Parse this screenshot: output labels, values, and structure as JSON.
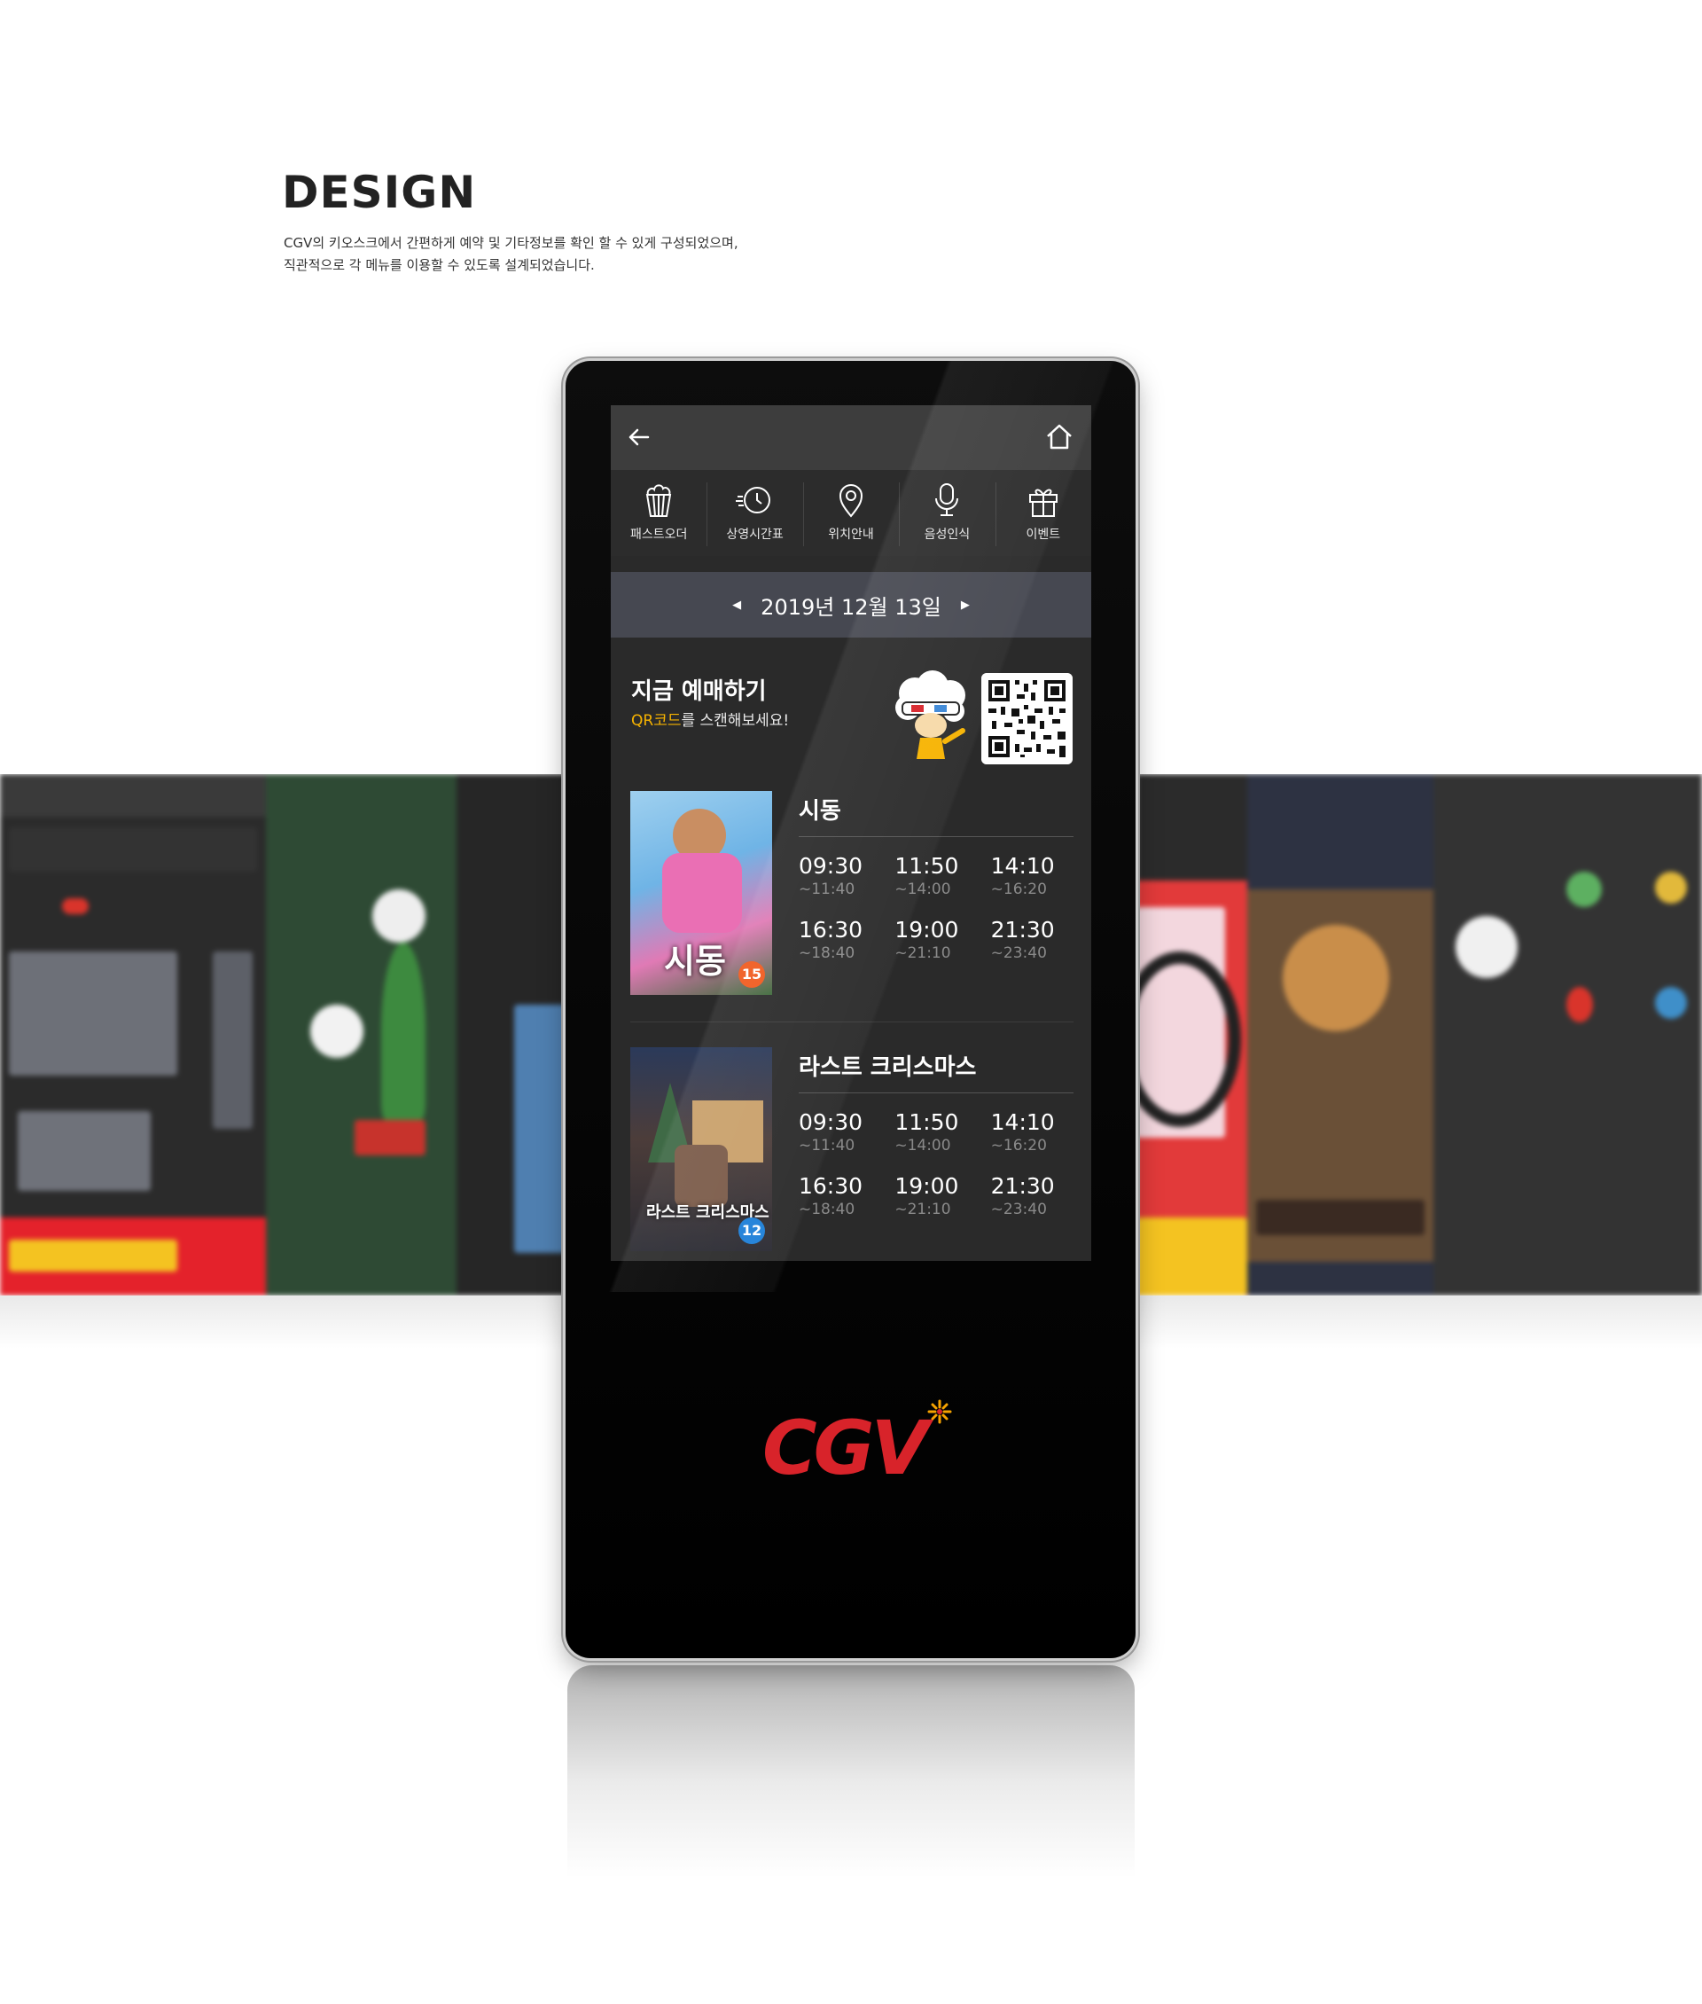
{
  "header": {
    "title": "DESIGN",
    "desc_line1": "CGV의 키오스크에서 간편하게 예약 및 기타정보를 확인 할 수 있게 구성되었으며,",
    "desc_line2": "직관적으로 각 메뉴를 이용할 수 있도록 설계되었습니다."
  },
  "kiosk": {
    "topbar": {
      "back_icon": "arrow-left-icon",
      "home_icon": "home-icon"
    },
    "menu": [
      {
        "label": "패스트오더",
        "icon": "popcorn-icon"
      },
      {
        "label": "상영시간표",
        "icon": "clock-icon"
      },
      {
        "label": "위치안내",
        "icon": "location-pin-icon"
      },
      {
        "label": "음성인식",
        "icon": "microphone-icon"
      },
      {
        "label": "이벤트",
        "icon": "gift-icon"
      }
    ],
    "date": {
      "prev": "◀",
      "label": "2019년 12월 13일",
      "next": "▶"
    },
    "promo": {
      "title": "지금 예매하기",
      "sub_highlight": "QR코드",
      "sub_rest": "를 스캔해보세요!"
    },
    "movies": [
      {
        "title": "시동",
        "poster_text": "시동",
        "rating": "15",
        "rating_color": "#f05a1e",
        "showtimes": [
          {
            "start": "09:30",
            "end": "~11:40"
          },
          {
            "start": "11:50",
            "end": "~14:00"
          },
          {
            "start": "14:10",
            "end": "~16:20"
          },
          {
            "start": "16:30",
            "end": "~18:40"
          },
          {
            "start": "19:00",
            "end": "~21:10"
          },
          {
            "start": "21:30",
            "end": "~23:40"
          }
        ]
      },
      {
        "title": "라스트 크리스마스",
        "poster_text": "라스트 크리스마스",
        "rating": "12",
        "rating_color": "#1d7fd8",
        "showtimes": [
          {
            "start": "09:30",
            "end": "~11:40"
          },
          {
            "start": "11:50",
            "end": "~14:00"
          },
          {
            "start": "14:10",
            "end": "~16:20"
          },
          {
            "start": "16:30",
            "end": "~18:40"
          },
          {
            "start": "19:00",
            "end": "~21:10"
          },
          {
            "start": "21:30",
            "end": "~23:40"
          }
        ]
      }
    ],
    "logo": "CGV"
  },
  "colors": {
    "accent_yellow": "#f7b300",
    "brand_red": "#d8232a",
    "screen_bg": "#2a2a2a",
    "date_bar": "#464851"
  }
}
